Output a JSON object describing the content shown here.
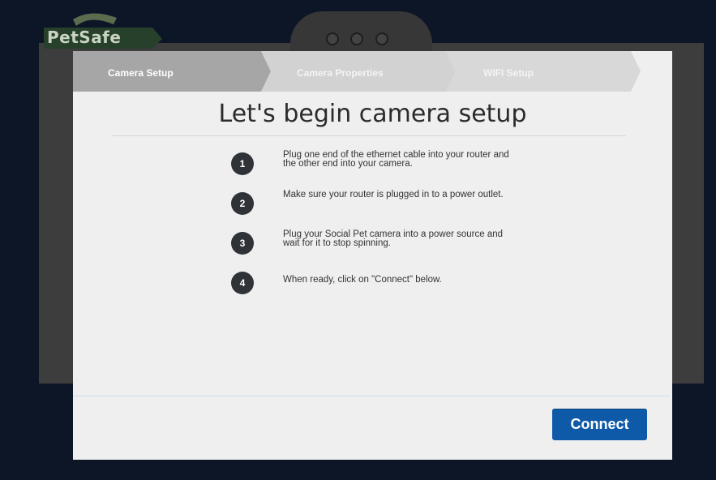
{
  "app": {
    "logo_text": "PetSafe"
  },
  "wizard": {
    "steps": [
      {
        "label": "Camera Setup",
        "active": true
      },
      {
        "label": "Camera Properties",
        "active": false
      },
      {
        "label": "WIFI Setup",
        "active": false
      }
    ],
    "title": "Let's begin camera setup",
    "instructions": [
      {
        "number": "1",
        "text": "Plug one end of the ethernet cable into your router and the other end into your camera."
      },
      {
        "number": "2",
        "text": "Make sure your router is plugged in to a power outlet."
      },
      {
        "number": "3",
        "text": "Plug your Social Pet camera into a power source and wait for it to stop spinning."
      },
      {
        "number": "4",
        "text": "When ready, click on \"Connect\" below."
      }
    ],
    "connect_label": "Connect"
  },
  "colors": {
    "accent": "#0f5aa8",
    "step_active": "#a6a6a6",
    "step_inactive": "#d2d2d2",
    "badge": "#2f3237"
  }
}
